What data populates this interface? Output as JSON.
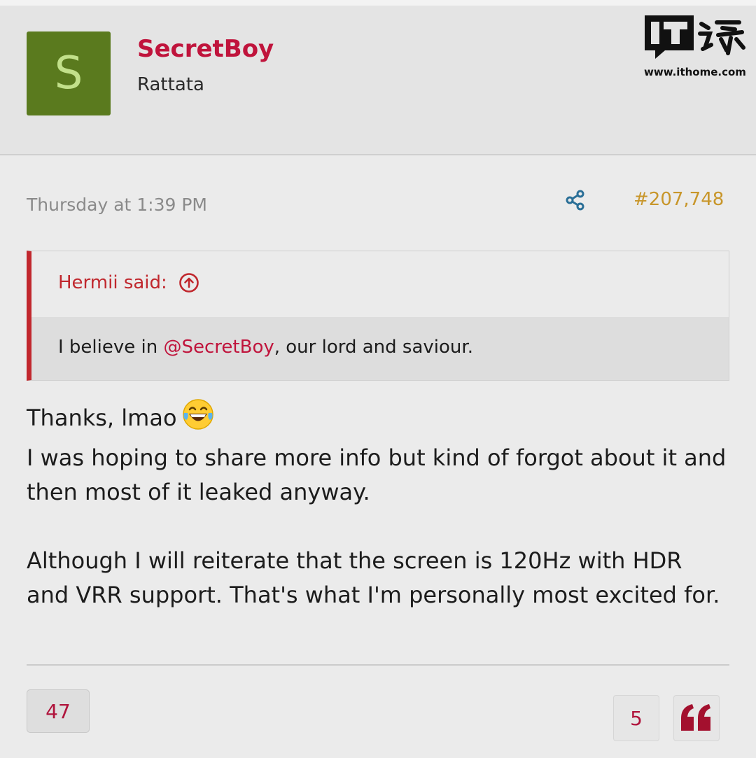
{
  "post": {
    "author": {
      "avatar_letter": "S",
      "name": "SecretBoy",
      "title": "Rattata",
      "avatar_color": "#5a7a1e",
      "name_color": "#c0143c"
    },
    "date": "Thursday at 1:39 PM",
    "number": "#207,748",
    "quote": {
      "attribution": "Hermii said:",
      "text_before": "I believe in ",
      "mention": "@SecretBoy",
      "text_after": ", our lord and saviour."
    },
    "body": {
      "line1": "Thanks, lmao",
      "line1_emoji": "face-with-tears-of-joy",
      "paragraph1": "I was hoping to share more info but kind of forgot about it and then most of it leaked anyway.",
      "paragraph2": "Although I will reiterate that the screen is 120Hz with HDR and VRR support. That's what I'm personally most excited for."
    },
    "reactions": {
      "count": "47"
    },
    "reply_count": "5"
  },
  "watermark": {
    "logo_text": "IT",
    "url": "www.ithome.com"
  },
  "colors": {
    "accent_red": "#c0143c",
    "quote_border": "#c1272d",
    "post_number": "#c8962a",
    "share_icon": "#2a6f97"
  }
}
